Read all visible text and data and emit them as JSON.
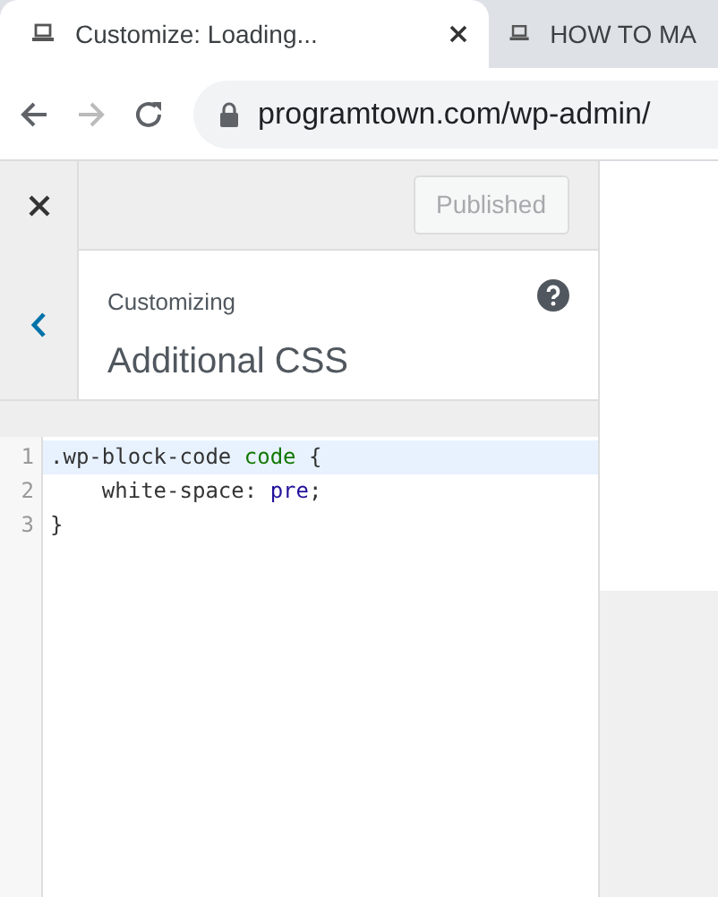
{
  "browser": {
    "tabs": [
      {
        "title": "Customize: Loading...",
        "selected": true
      },
      {
        "title": "HOW TO MA",
        "selected": false
      }
    ],
    "nav": {
      "back_disabled": false,
      "forward_disabled": true
    },
    "address": "programtown.com/wp-admin/"
  },
  "customizer": {
    "publish_button": {
      "label": "Published",
      "disabled": true
    },
    "section": {
      "breadcrumb": "Customizing",
      "title": "Additional CSS"
    },
    "editor": {
      "lines": [
        {
          "number": "1",
          "active": true,
          "tokens": [
            {
              "kind": "plain",
              "text": ".wp-block-code "
            },
            {
              "kind": "tag",
              "text": "code"
            },
            {
              "kind": "plain",
              "text": " {"
            }
          ]
        },
        {
          "number": "2",
          "active": false,
          "tokens": [
            {
              "kind": "plain",
              "text": "    white-space: "
            },
            {
              "kind": "keyword",
              "text": "pre"
            },
            {
              "kind": "plain",
              "text": ";"
            }
          ]
        },
        {
          "number": "3",
          "active": false,
          "tokens": [
            {
              "kind": "plain",
              "text": "}"
            }
          ]
        }
      ]
    }
  }
}
